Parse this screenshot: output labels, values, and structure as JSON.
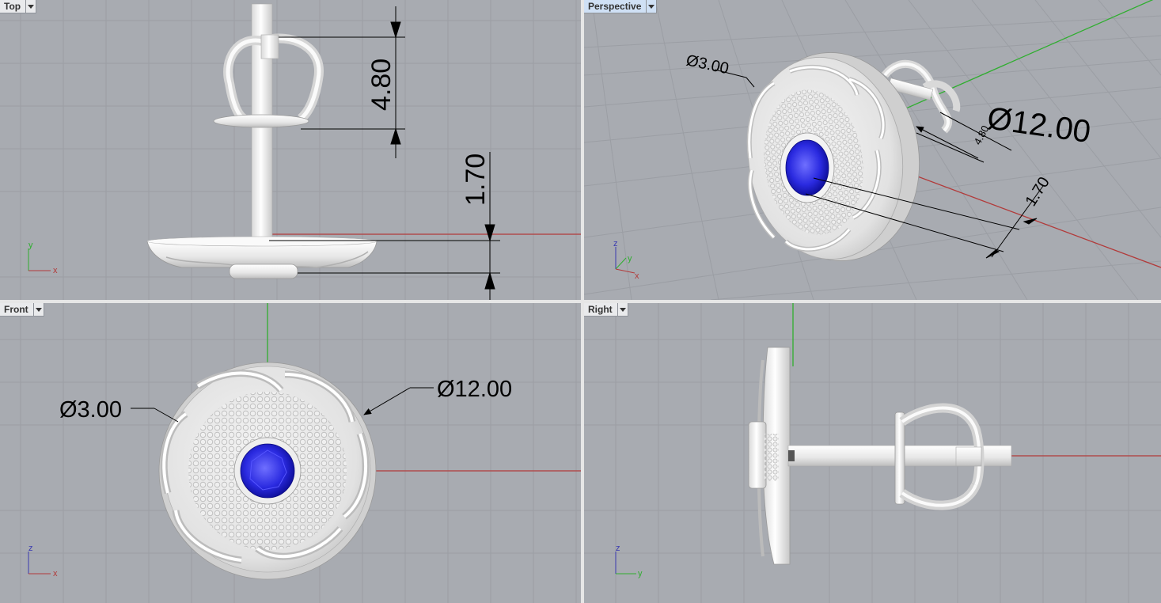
{
  "viewports": {
    "top": {
      "name": "Top",
      "dims": {
        "crown_height": "4.80",
        "head_height": "1.70"
      },
      "axes": {
        "v": "y",
        "h": "x"
      }
    },
    "perspective": {
      "name": "Perspective",
      "dims": {
        "stone": "Ø3.00",
        "head": "Ø12.00",
        "small": "4.80",
        "height": "1.70"
      },
      "axes": {
        "v": "z",
        "a": "y",
        "b": "x"
      }
    },
    "front": {
      "name": "Front",
      "dims": {
        "stone": "Ø3.00",
        "head": "Ø12.00"
      },
      "axes": {
        "v": "z",
        "h": "x"
      }
    },
    "right": {
      "name": "Right",
      "axes": {
        "v": "z",
        "h": "y"
      }
    }
  },
  "colors": {
    "viewport_bg": "#a8abb1",
    "grid": "#9a9da3",
    "x_axis": "#b23a3a",
    "y_axis": "#2fae2f",
    "stone": "#1a1ad6",
    "metal": "#f2f2f2"
  }
}
